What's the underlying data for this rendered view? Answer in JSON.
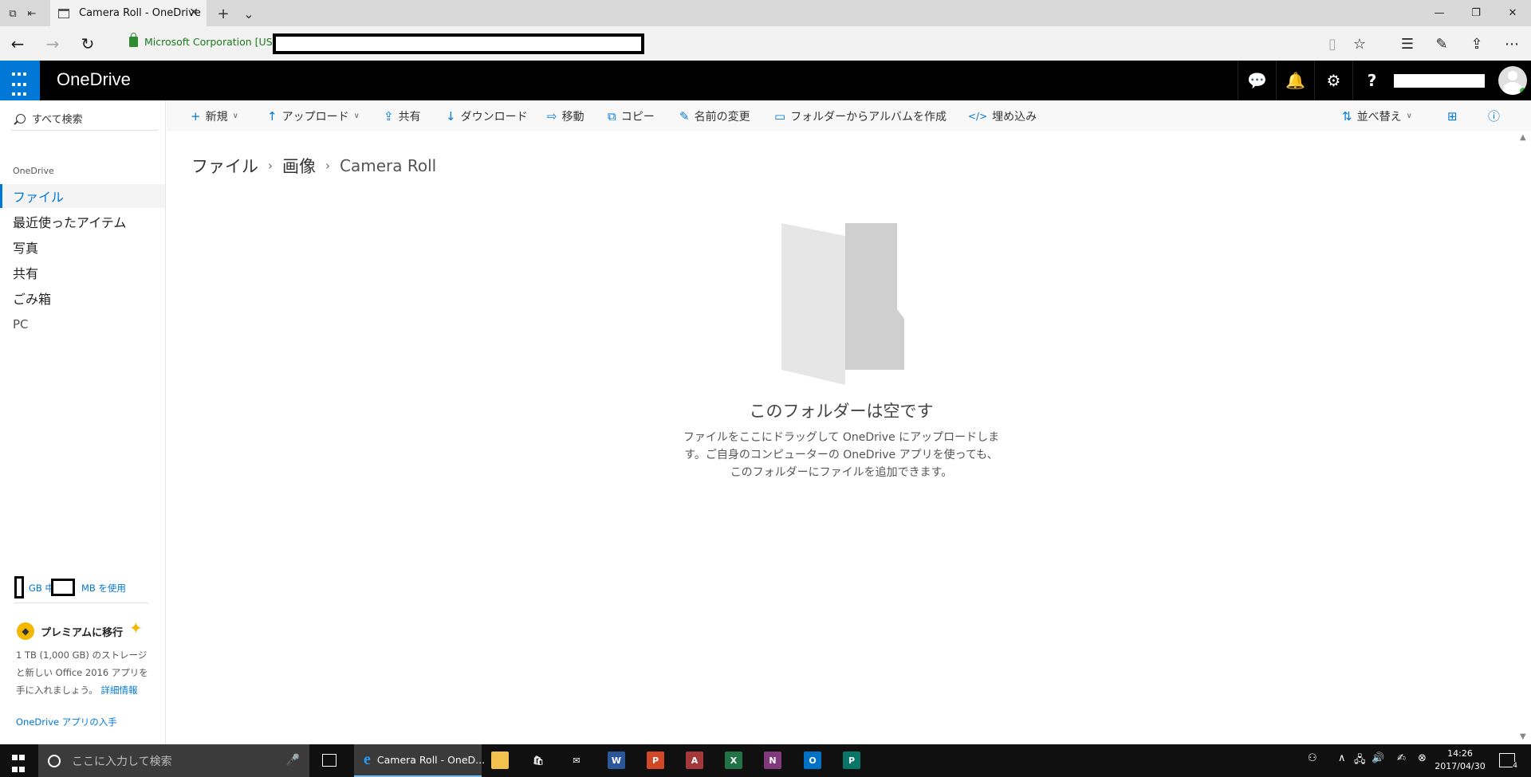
{
  "browser": {
    "tab_title": "Camera Roll - OneDrive",
    "tab_close": "✕",
    "new_tab": "+",
    "tab_list": "⌄",
    "win_minimize": "—",
    "win_restore": "❐",
    "win_close": "✕",
    "back": "←",
    "forward": "→",
    "refresh": "↻",
    "site_identity": "Microsoft Corporation [US]",
    "reading_view": "▯",
    "favorite": "☆",
    "hub": "☰",
    "notes": "✎",
    "share": "⇪",
    "more": "⋯"
  },
  "header": {
    "brand": "OneDrive",
    "chat_icon": "💬",
    "bell_icon": "🔔",
    "gear_icon": "⚙",
    "help_icon": "?"
  },
  "leftnav": {
    "search_label": "すべて検索",
    "section_label": "OneDrive",
    "items": [
      {
        "label": "ファイル"
      },
      {
        "label": "最近使ったアイテム"
      },
      {
        "label": "写真"
      },
      {
        "label": "共有"
      },
      {
        "label": "ごみ箱"
      },
      {
        "label": "PC"
      }
    ],
    "quota_gb": "GB 中",
    "quota_mb": "MB を使用",
    "premium_title": "プレミアムに移行",
    "premium_desc": "1 TB (1,000 GB) のストレージと新しい Office 2016 アプリを手に入れましょう。",
    "premium_link": "詳細情報",
    "get_app": "OneDrive アプリの入手"
  },
  "commands": {
    "new": "新規",
    "upload": "アップロード",
    "share": "共有",
    "download": "ダウンロード",
    "move": "移動",
    "copy": "コピー",
    "rename": "名前の変更",
    "create_album": "フォルダーからアルバムを作成",
    "embed": "埋め込み",
    "sort": "並べ替え"
  },
  "breadcrumb": {
    "root": "ファイル",
    "middle": "画像",
    "current": "Camera Roll",
    "sep": "›"
  },
  "empty": {
    "title": "このフォルダーは空です",
    "desc": "ファイルをここにドラッグして OneDrive にアップロードします。ご自身のコンピューターの OneDrive アプリを使っても、このフォルダーにファイルを追加できます。"
  },
  "taskbar": {
    "search_placeholder": "ここに入力して検索",
    "edge_title": "Camera Roll - OneD...",
    "apps": [
      {
        "name": "file-explorer",
        "letter": "",
        "color": "#f2c14e"
      },
      {
        "name": "store",
        "letter": "🛍",
        "color": "#101010"
      },
      {
        "name": "mail",
        "letter": "✉",
        "color": "#101010"
      },
      {
        "name": "word",
        "letter": "W",
        "color": "#2b579a"
      },
      {
        "name": "powerpoint",
        "letter": "P",
        "color": "#d24726"
      },
      {
        "name": "access",
        "letter": "A",
        "color": "#a4373a"
      },
      {
        "name": "excel",
        "letter": "X",
        "color": "#217346"
      },
      {
        "name": "onenote",
        "letter": "N",
        "color": "#80397b"
      },
      {
        "name": "outlook",
        "letter": "O",
        "color": "#0072c6"
      },
      {
        "name": "publisher",
        "letter": "P",
        "color": "#077568"
      }
    ],
    "time": "14:26",
    "date": "2017/04/30",
    "notification_count": "4"
  },
  "colors": {
    "accent": "#0078d7",
    "header_bg": "#000000",
    "site_identity": "#1a7a1a"
  }
}
